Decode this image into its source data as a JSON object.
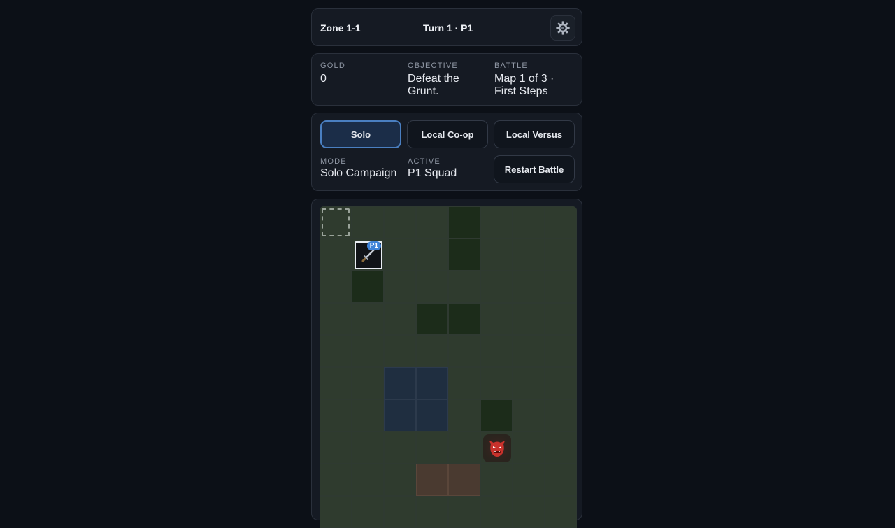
{
  "header": {
    "zone": "Zone 1-1",
    "turn": "Turn 1 · P1",
    "settings_icon": "gear-icon"
  },
  "stats": {
    "gold_label": "GOLD",
    "gold_value": "0",
    "objective_label": "OBJECTIVE",
    "objective_value": "Defeat the Grunt.",
    "battle_label": "BATTLE",
    "battle_value": "Map 1 of 3 · First Steps"
  },
  "modes": {
    "buttons": [
      "Solo",
      "Local Co-op",
      "Local Versus"
    ],
    "active_mode": "Solo",
    "mode_label": "MODE",
    "mode_value": "Solo Campaign",
    "active_label": "ACTIVE",
    "active_value": "P1 Squad",
    "restart_label": "Restart Battle"
  },
  "board": {
    "columns": 8,
    "visible_rows": 10,
    "terrain": [
      [
        "sel",
        "plain",
        "plain",
        "plain",
        "forest",
        "plain",
        "plain",
        "plain"
      ],
      [
        "plain",
        "plain",
        "plain",
        "plain",
        "forest",
        "plain",
        "plain",
        "plain"
      ],
      [
        "plain",
        "forest",
        "plain",
        "plain",
        "plain",
        "plain",
        "plain",
        "plain"
      ],
      [
        "plain",
        "plain",
        "plain",
        "forest",
        "forest",
        "plain",
        "plain",
        "plain"
      ],
      [
        "plain",
        "plain",
        "plain",
        "plain",
        "plain",
        "plain",
        "plain",
        "plain"
      ],
      [
        "plain",
        "plain",
        "water",
        "water",
        "plain",
        "plain",
        "plain",
        "plain"
      ],
      [
        "plain",
        "plain",
        "water",
        "water",
        "plain",
        "forest",
        "plain",
        "plain"
      ],
      [
        "plain",
        "plain",
        "plain",
        "plain",
        "plain",
        "plain",
        "plain",
        "plain"
      ],
      [
        "plain",
        "plain",
        "plain",
        "hill",
        "hill",
        "plain",
        "plain",
        "plain"
      ],
      [
        "plain",
        "plain",
        "plain",
        "plain",
        "plain",
        "plain",
        "plain",
        "plain"
      ]
    ],
    "units": [
      {
        "row": 1,
        "col": 1,
        "icon": "sword-icon",
        "badge": "P1",
        "side": "player"
      },
      {
        "row": 7,
        "col": 5,
        "icon": "demon-mask-icon",
        "badge": "",
        "side": "enemy"
      }
    ],
    "colors": {
      "plain": "#2f3b2e",
      "forest": "#1c2c1a",
      "water": "#1f2e40",
      "hill": "#4a3a30",
      "player_badge": "#3f84d8",
      "enemy": "#c8322c"
    }
  }
}
